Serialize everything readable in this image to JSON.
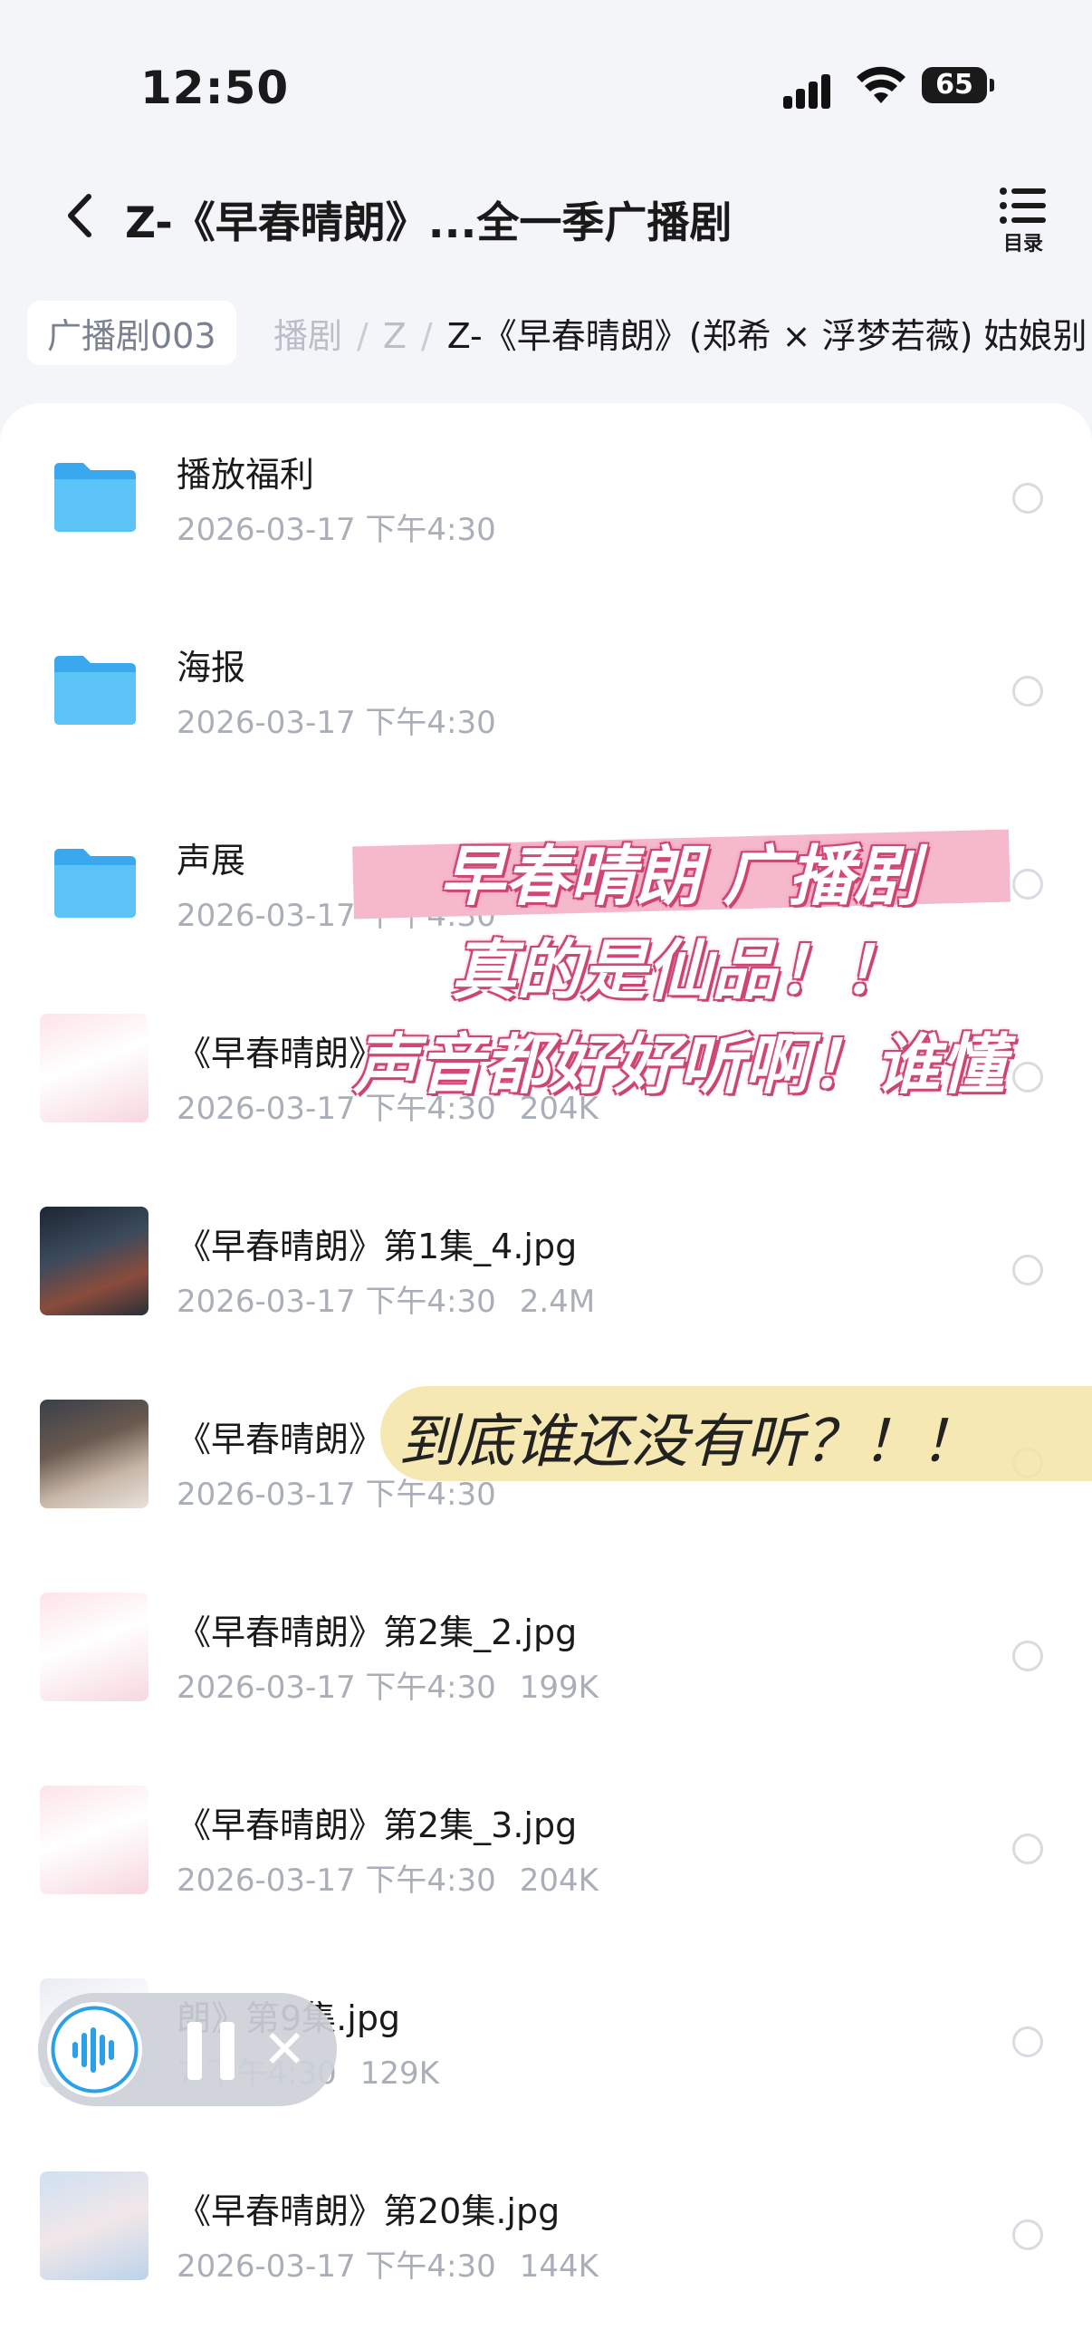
{
  "status": {
    "time": "12:50",
    "battery": "65"
  },
  "nav": {
    "title": "Z-《早春晴朗》...全一季广播剧",
    "toc_label": "目录"
  },
  "breadcrumbs": {
    "first": "广播剧003",
    "faded": "播剧",
    "sep": "/",
    "middle": "Z",
    "current": "Z-《早春晴朗》(郑希 × 浮梦若薇) 姑娘别"
  },
  "files": [
    {
      "name": "播放福利",
      "date": "2026-03-17 下午4:30",
      "size": "",
      "icon": "folder-icon"
    },
    {
      "name": "海报",
      "date": "2026-03-17 下午4:30",
      "size": "",
      "icon": "folder-icon"
    },
    {
      "name": "声展",
      "date": "2026-03-17 下午4:30",
      "size": "",
      "icon": "folder-icon"
    },
    {
      "name": "《早春晴朗》",
      "date": "2026-03-17 下午4:30",
      "size": "204K",
      "icon": "image-thumbnail"
    },
    {
      "name": "《早春晴朗》第1集_4.jpg",
      "date": "2026-03-17 下午4:30",
      "size": "2.4M",
      "icon": "image-thumbnail"
    },
    {
      "name": "《早春晴朗》",
      "date": "2026-03-17 下午4:30",
      "size": "",
      "icon": "image-thumbnail"
    },
    {
      "name": "《早春晴朗》第2集_2.jpg",
      "date": "2026-03-17 下午4:30",
      "size": "199K",
      "icon": "image-thumbnail"
    },
    {
      "name": "《早春晴朗》第2集_3.jpg",
      "date": "2026-03-17 下午4:30",
      "size": "204K",
      "icon": "image-thumbnail"
    },
    {
      "name": "朗》第9集.jpg",
      "date": "7 下午4:30",
      "size": "129K",
      "icon": "image-thumbnail"
    },
    {
      "name": "《早春晴朗》第20集.jpg",
      "date": "2026-03-17 下午4:30",
      "size": "144K",
      "icon": "image-thumbnail"
    }
  ],
  "overlay_pink": {
    "line1": "早春晴朗 广播剧",
    "line2": "真的是仙品！！",
    "line3": "声音都好好听啊！谁懂"
  },
  "overlay_yellow": {
    "text": "到底谁还没有听？！！"
  },
  "colors": {
    "folder": "#4db7f3",
    "accent_pink": "#f6b8cb",
    "yellow_wash": "#f3e4a6",
    "meta_gray": "#a9aeb8"
  }
}
